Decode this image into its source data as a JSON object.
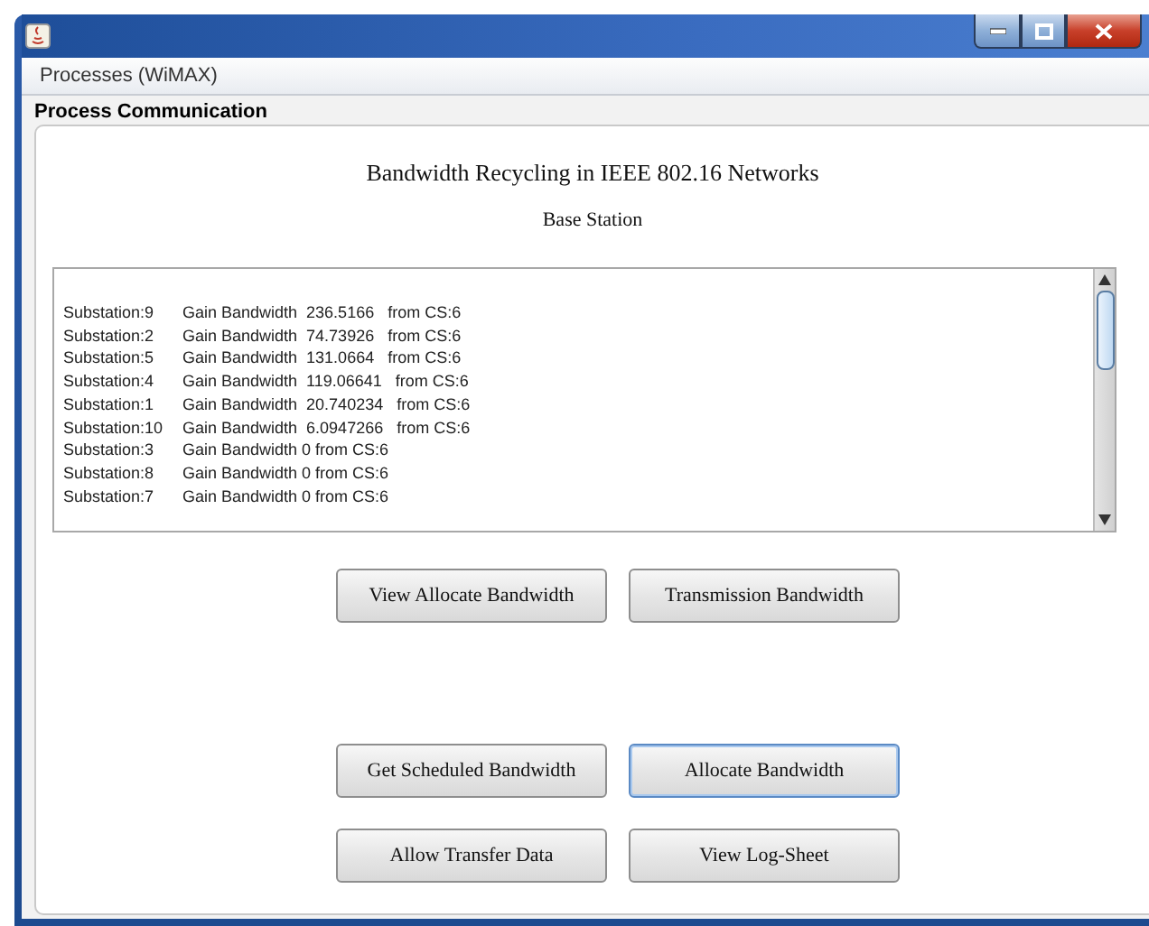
{
  "menu_bar": {
    "items": [
      "Processes (WiMAX)"
    ]
  },
  "panel": {
    "title": "Process Communication"
  },
  "heading": "Bandwidth Recycling in IEEE 802.16 Networks",
  "subheading": "Base Station",
  "log": [
    {
      "station": "Substation:9",
      "message": "Gain Bandwidth  236.5166   from CS:6"
    },
    {
      "station": "Substation:2",
      "message": "Gain Bandwidth  74.73926   from CS:6"
    },
    {
      "station": "Substation:5",
      "message": "Gain Bandwidth  131.0664   from CS:6"
    },
    {
      "station": "Substation:4",
      "message": "Gain Bandwidth  119.06641   from CS:6"
    },
    {
      "station": "Substation:1",
      "message": "Gain Bandwidth  20.740234   from CS:6"
    },
    {
      "station": "Substation:10",
      "message": "Gain Bandwidth  6.0947266   from CS:6"
    },
    {
      "station": "Substation:3",
      "message": "Gain Bandwidth 0 from CS:6"
    },
    {
      "station": "Substation:8",
      "message": "Gain Bandwidth 0 from CS:6"
    },
    {
      "station": "Substation:7",
      "message": "Gain Bandwidth 0 from CS:6"
    }
  ],
  "button_rows": [
    [
      {
        "label": "View Allocate Bandwidth",
        "focused": false
      },
      {
        "label": "Transmission Bandwidth",
        "focused": false
      }
    ],
    [
      {
        "label": "Get Scheduled Bandwidth",
        "focused": false
      },
      {
        "label": "Allocate Bandwidth",
        "focused": true
      }
    ],
    [
      {
        "label": "Allow Transfer Data",
        "focused": false
      },
      {
        "label": "View Log-Sheet",
        "focused": false
      }
    ]
  ]
}
